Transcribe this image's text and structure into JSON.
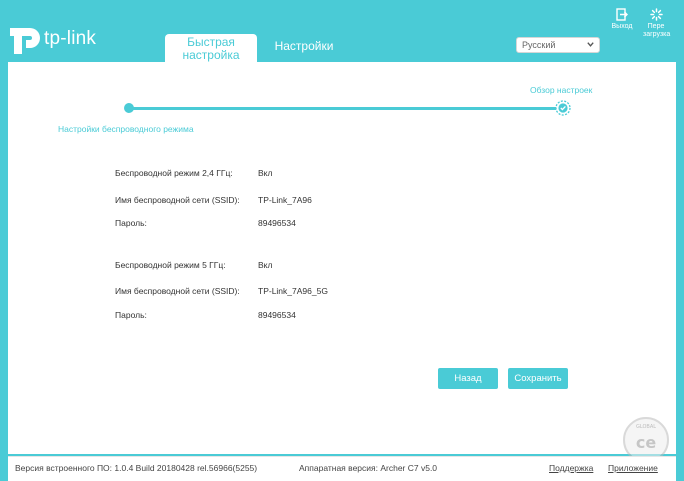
{
  "header": {
    "logo_text": "tp-link",
    "tabs": [
      {
        "label_line1": "Быстрая",
        "label_line2": "настройка"
      },
      {
        "label": "Настройки"
      }
    ],
    "language": "Русский",
    "logout_label": "Выход",
    "reboot_label_line1": "Пере",
    "reboot_label_line2": "загрузка"
  },
  "wizard": {
    "step_first": "Настройки беспроводного режима",
    "step_last": "Обзор настроек"
  },
  "summary": {
    "rows": [
      {
        "label": "Беспроводной режим 2,4 ГГц:",
        "value": "Вкл"
      },
      {
        "label": "Имя беспроводной сети (SSID):",
        "value": "TP-Link_7A96"
      },
      {
        "label": "Пароль:",
        "value": "89496534"
      },
      {
        "label": "Беспроводной режим 5 ГГц:",
        "value": "Вкл"
      },
      {
        "label": "Имя беспроводной сети (SSID):",
        "value": "TP-Link_7A96_5G"
      },
      {
        "label": "Пароль:",
        "value": "89496534"
      }
    ]
  },
  "buttons": {
    "back": "Назад",
    "save": "Сохранить"
  },
  "footer": {
    "firmware": "Версия встроенного ПО: 1.0.4 Build 20180428 rel.56966(5255)",
    "hardware": "Аппаратная версия: Archer C7 v5.0",
    "support": "Поддержка",
    "app": "Приложение"
  },
  "watermark_text": "GLOBAL"
}
